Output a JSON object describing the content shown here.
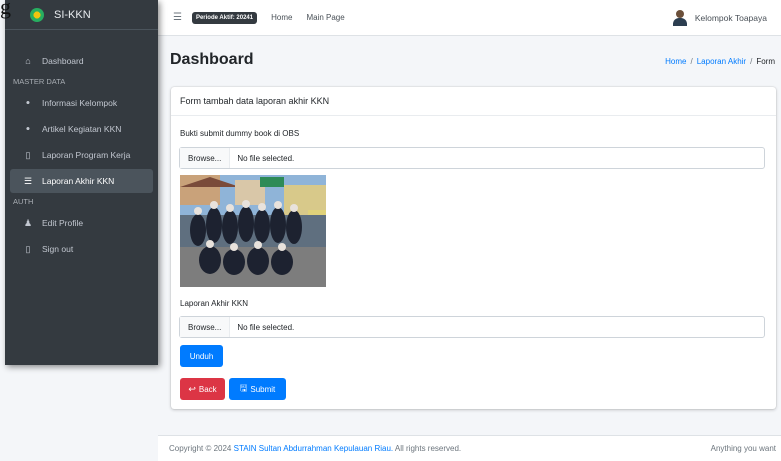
{
  "corner_glyph": "g",
  "brand": {
    "title": "SI-KKN"
  },
  "sidebar": {
    "dashboard": "Dashboard",
    "section_master": "MASTER DATA",
    "informasi_kelompok": "Informasi Kelompok",
    "artikel_kegiatan": "Artikel Kegiatan KKN",
    "laporan_program": "Laporan Program Kerja",
    "laporan_akhir": "Laporan Akhir KKN",
    "section_auth": "AUTH",
    "edit_profile": "Edit Profile",
    "sign_out": "Sign out"
  },
  "topbar": {
    "period_badge": "Periode Aktif: 20241",
    "home": "Home",
    "main_page": "Main Page",
    "user_name": "Kelompok Toapaya"
  },
  "content": {
    "title": "Dashboard",
    "breadcrumb": {
      "home": "Home",
      "laporan_akhir": "Laporan Akhir",
      "current": "Form",
      "separator": "/"
    }
  },
  "card": {
    "header": "Form tambah data laporan akhir KKN",
    "field1_label": "Bukti submit dummy book di OBS",
    "field2_label": "Laporan Akhir KKN",
    "browse": "Browse...",
    "no_file": "No file selected.",
    "unduh": "Unduh",
    "back": "Back",
    "submit": "Submit"
  },
  "footer": {
    "prefix": "Copyright © 2024",
    "link": "STAIN Sultan Abdurrahman Kepulauan Riau.",
    "suffix": "All rights reserved.",
    "right": "Anything you want"
  },
  "colors": {
    "sidebar_bg": "#343a40",
    "primary": "#007bff",
    "danger": "#dc3545"
  }
}
